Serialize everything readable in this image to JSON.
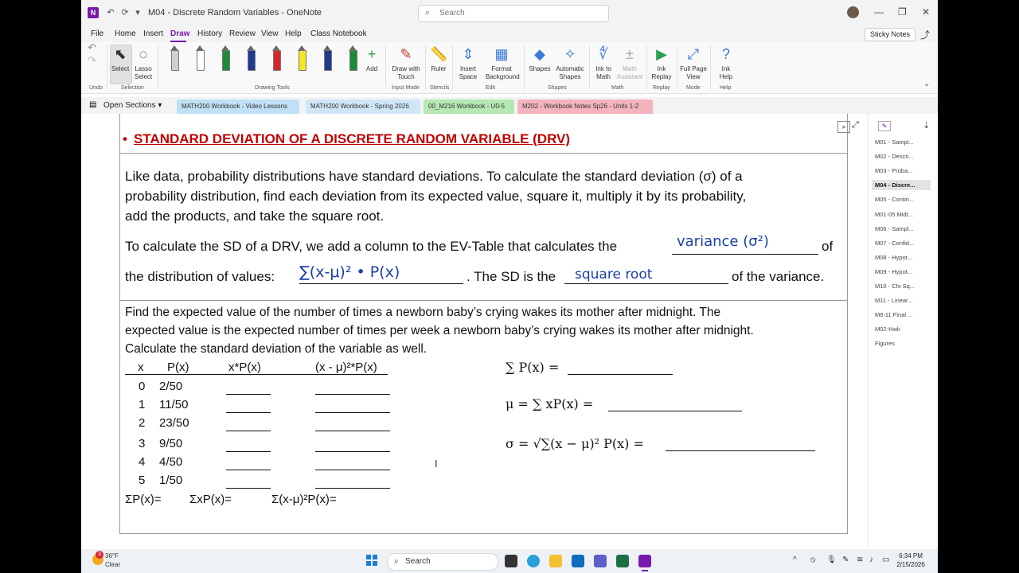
{
  "titlebar": {
    "title": "M04 - Discrete Random Variables - OneNote",
    "search_placeholder": "Search"
  },
  "menu": [
    "File",
    "Home",
    "Insert",
    "Draw",
    "History",
    "Review",
    "View",
    "Help",
    "Class Notebook"
  ],
  "menu_active": "Draw",
  "sticky_notes_label": "Sticky Notes",
  "ribbon": {
    "undo_group": "Undo",
    "select_label": "Select",
    "lasso_label": "Lasso Select",
    "selection_group": "Selection",
    "add_label": "Add",
    "drawing_tools_group": "Drawing Tools",
    "draw_with_touch": "Draw with Touch",
    "input_mode_group": "Input Mode",
    "ruler": "Ruler",
    "stencils_group": "Stencils",
    "insert_space": "Insert Space",
    "format_background": "Format Background",
    "edit_group": "Edit",
    "shapes": "Shapes",
    "automatic_shapes": "Automatic Shapes",
    "shapes_group": "Shapes",
    "ink_to_math": "Ink to Math",
    "math_assistant": "Math Assistant",
    "math_group": "Math",
    "ink_replay": "Ink Replay",
    "replay_group": "Replay",
    "full_page_view": "Full Page View",
    "mode_group": "Mode",
    "ink_help": "Ink Help",
    "help_group": "Help",
    "pen_colors": [
      "#cfcfcf",
      "#ffffff",
      "#1e8a3c",
      "#1f3a8f",
      "#d9262e",
      "#f5e623",
      "#1f3a8f",
      "#1e8a3c"
    ]
  },
  "tabs": {
    "open_sections": "Open Sections",
    "notebooks": [
      {
        "label": "MATH200 Workbook - Video Lessons",
        "color": "#bfe0f5"
      },
      {
        "label": "MATH200 Workbook - Spring 2026",
        "color": "#cfe6f7"
      },
      {
        "label": "00_M216 Workbook - U0-5",
        "color": "#b6e8b3"
      },
      {
        "label": "M202 - Workbook Notes Sp26 - Units 1-2",
        "color": "#f5b3bf"
      }
    ]
  },
  "content": {
    "heading": "STANDARD DEVIATION OF A DISCRETE RANDOM VARIABLE (DRV)",
    "bullet": "•",
    "p1_line1": "Like data, probability distributions have standard deviations. To calculate the standard deviation (σ) of a",
    "p1_line2": "probability distribution, find each deviation from its expected value, square it, multiply it by its probability,",
    "p1_line3": "add the products, and take the square root.",
    "p2_line1_a": "To calculate the SD of a DRV, we add a column to the EV-Table that calculates the",
    "p2_line1_b": "of",
    "p2_line2_a": "the distribution of values:",
    "p2_line2_b": ".  The SD is the",
    "p2_line2_c": "of the variance.",
    "hw_variance": "variance (σ²)",
    "hw_sum": "∑(x-μ)² • P(x)",
    "hw_sqrt": "square root",
    "ex_line1": "Find the expected value of the number of times a newborn baby’s crying wakes its mother after midnight. The",
    "ex_line2": "expected value is the expected number of times per week a newborn baby’s crying wakes its mother after midnight.",
    "ex_line3": "Calculate the standard deviation of the variable as well.",
    "table_headers": [
      "x",
      "P(x)",
      "x*P(x)",
      "(x - μ)²*P(x)"
    ],
    "table_rows": [
      {
        "x": "0",
        "p": "2/50"
      },
      {
        "x": "1",
        "p": "11/50"
      },
      {
        "x": "2",
        "p": "23/50"
      },
      {
        "x": "3",
        "p": "9/50"
      },
      {
        "x": "4",
        "p": "4/50"
      },
      {
        "x": "5",
        "p": "1/50"
      }
    ],
    "sum_p": "ΣP(x)=",
    "sum_xp": "ΣxP(x)=",
    "sum_var": "Σ(x-μ)²P(x)=",
    "eq1": "∑ P(x) =",
    "eq2": "μ = ∑ xP(x) =",
    "eq3": "σ = √∑(x − μ)² P(x) ="
  },
  "pages": [
    "M01 - Sampl...",
    "M02 - Descri...",
    "M03 - Proba...",
    "M04 - Discre...",
    "M05 - Contin...",
    "M01-05 Midt...",
    "M06 - Sampl...",
    "M07 - Confid...",
    "M08 - Hypot...",
    "M09 - Hypot...",
    "M10 - Chi Sq...",
    "M11 - Linear...",
    "M6-11 Final ...",
    "M02-Hwk",
    "Figures"
  ],
  "selected_page": "M04 - Discre...",
  "taskbar": {
    "weather_temp": "36°F",
    "weather_desc": "Clear",
    "search_label": "Search",
    "time": "6:34 PM",
    "date": "2/15/2026",
    "badge": "3"
  }
}
